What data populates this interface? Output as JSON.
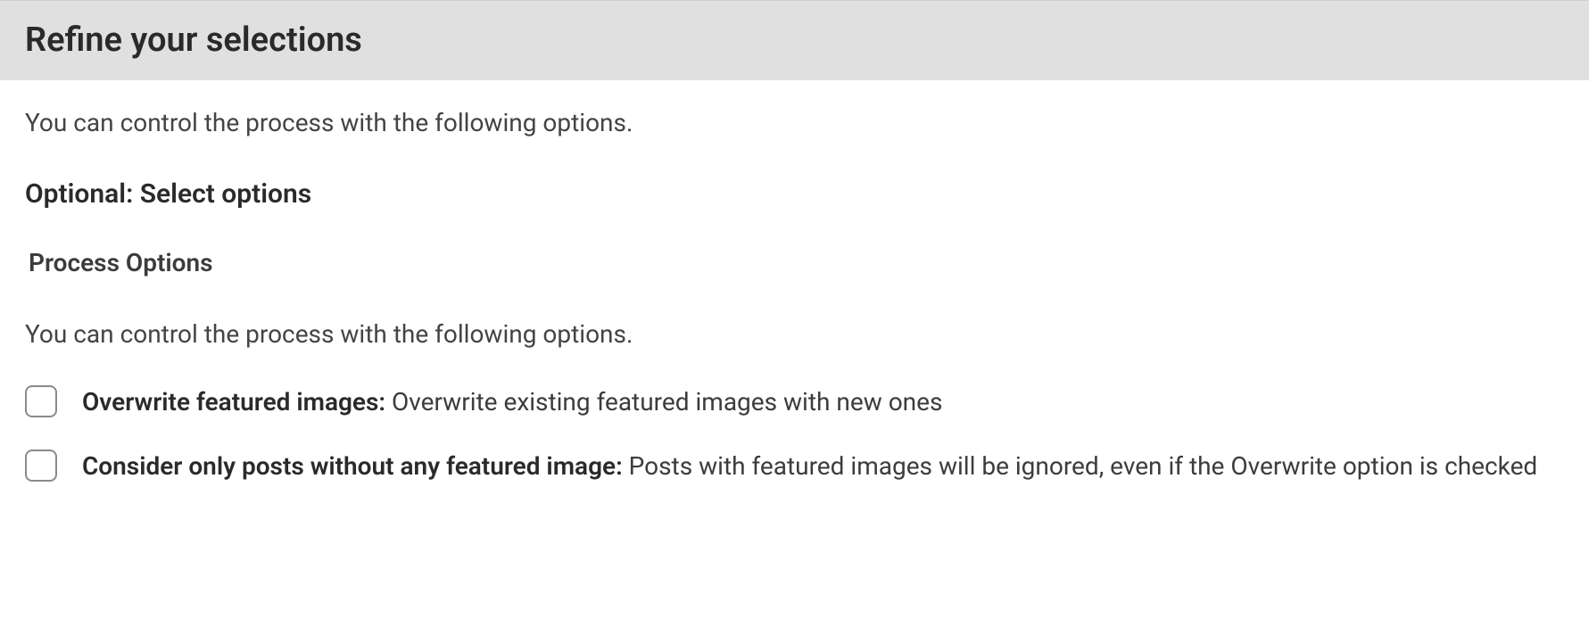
{
  "header": {
    "title": "Refine your selections"
  },
  "content": {
    "description1": "You can control the process with the following options.",
    "subheading": "Optional: Select options",
    "section_heading": "Process Options",
    "description2": "You can control the process with the following options.",
    "options": [
      {
        "label_bold": "Overwrite featured images:",
        "label_rest": " Overwrite existing featured images with new ones"
      },
      {
        "label_bold": "Consider only posts without any featured image:",
        "label_rest": " Posts with featured images will be ignored, even if the Overwrite option is checked"
      }
    ]
  }
}
